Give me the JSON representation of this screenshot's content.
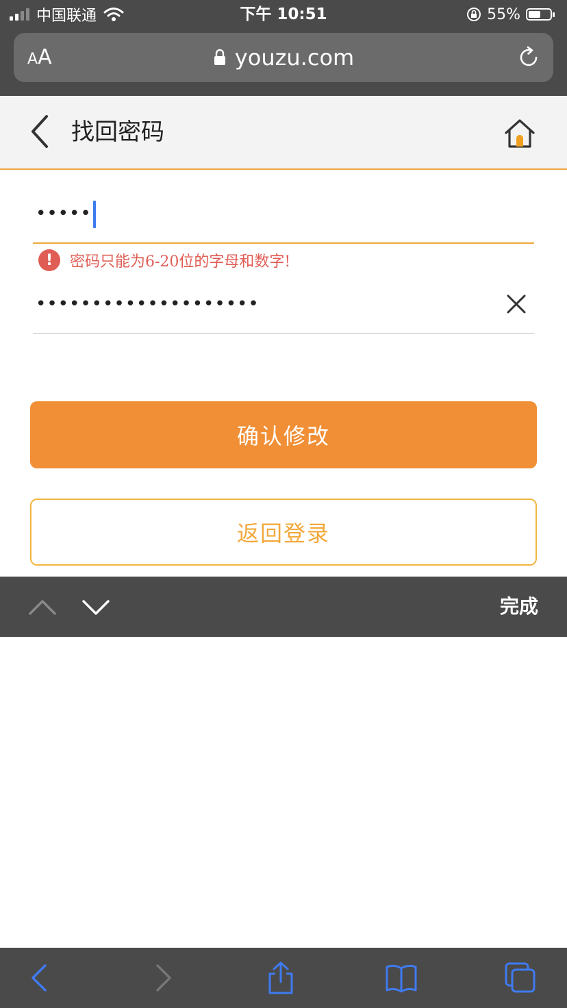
{
  "status_bar": {
    "carrier": "中国联通",
    "time": "下午 10:51",
    "battery": "55%",
    "battery_level": 0.55
  },
  "browser": {
    "text_size_label_small": "A",
    "text_size_label_large": "A",
    "domain": "youzu.com"
  },
  "header": {
    "title": "找回密码"
  },
  "form": {
    "password": {
      "value_masked": "•••••"
    },
    "error_icon": "!",
    "error_message": "密码只能为6-20位的字母和数字!",
    "confirm_password": {
      "value_masked": "••••••••••••••••••••"
    },
    "confirm_button": "确认修改",
    "back_login_button": "返回登录"
  },
  "keyboard_accessory": {
    "done_label": "完成"
  },
  "colors": {
    "accent_orange": "#f08f35",
    "border_orange": "#f2b640",
    "error_red": "#e05d55",
    "caret_blue": "#3f7bf1",
    "toolbar_gray": "#4a4a4a"
  },
  "icons": {
    "back": "chevron-left-icon",
    "home": "home-icon",
    "clear": "close-icon",
    "lock": "lock-icon",
    "reload": "reload-icon",
    "prev_field": "chevron-up-icon",
    "next_field": "chevron-down-icon",
    "share": "share-icon",
    "bookmarks": "book-icon",
    "tabs": "tabs-icon"
  }
}
